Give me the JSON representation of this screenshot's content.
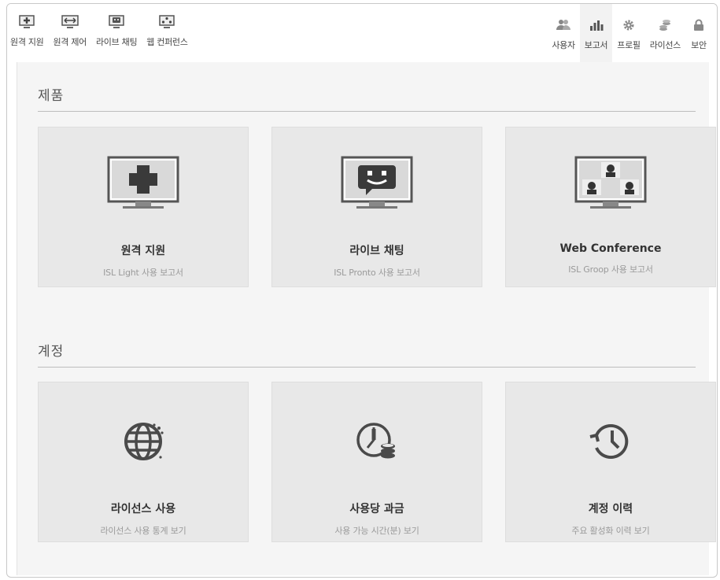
{
  "nav_left": [
    {
      "label": "원격 지원",
      "icon": "remote-support-icon"
    },
    {
      "label": "원격 제어",
      "icon": "remote-control-icon"
    },
    {
      "label": "라이브 채팅",
      "icon": "live-chat-icon"
    },
    {
      "label": "웹 컨퍼런스",
      "icon": "web-conference-icon"
    }
  ],
  "nav_right": [
    {
      "label": "사용자",
      "icon": "users-icon",
      "active": false
    },
    {
      "label": "보고서",
      "icon": "reports-icon",
      "active": true
    },
    {
      "label": "프로필",
      "icon": "gear-icon",
      "active": false
    },
    {
      "label": "라이선스",
      "icon": "license-icon",
      "active": false
    },
    {
      "label": "보안",
      "icon": "lock-icon",
      "active": false
    }
  ],
  "sections": {
    "products": {
      "title": "제품",
      "cards": [
        {
          "title": "원격 지원",
          "subtitle": "ISL Light 사용 보고서",
          "icon": "monitor-plus-icon"
        },
        {
          "title": "라이브 채팅",
          "subtitle": "ISL Pronto 사용 보고서",
          "icon": "monitor-chat-icon"
        },
        {
          "title": "Web Conference",
          "subtitle": "ISL Groop 사용 보고서",
          "icon": "monitor-conference-icon"
        }
      ]
    },
    "account": {
      "title": "계정",
      "cards": [
        {
          "title": "라이선스 사용",
          "subtitle": "라이선스 사용 통계 보기",
          "icon": "globe-icon"
        },
        {
          "title": "사용당 과금",
          "subtitle": "사용 가능 시간(분) 보기",
          "icon": "clock-coins-icon"
        },
        {
          "title": "계정 이력",
          "subtitle": "주요 활성화 이력 보기",
          "icon": "history-icon"
        }
      ]
    }
  },
  "colors": {
    "background": "#f5f5f5",
    "card": "#e8e8e8",
    "rule": "#bdbdbd",
    "active_tab": "#f2f2f2"
  }
}
